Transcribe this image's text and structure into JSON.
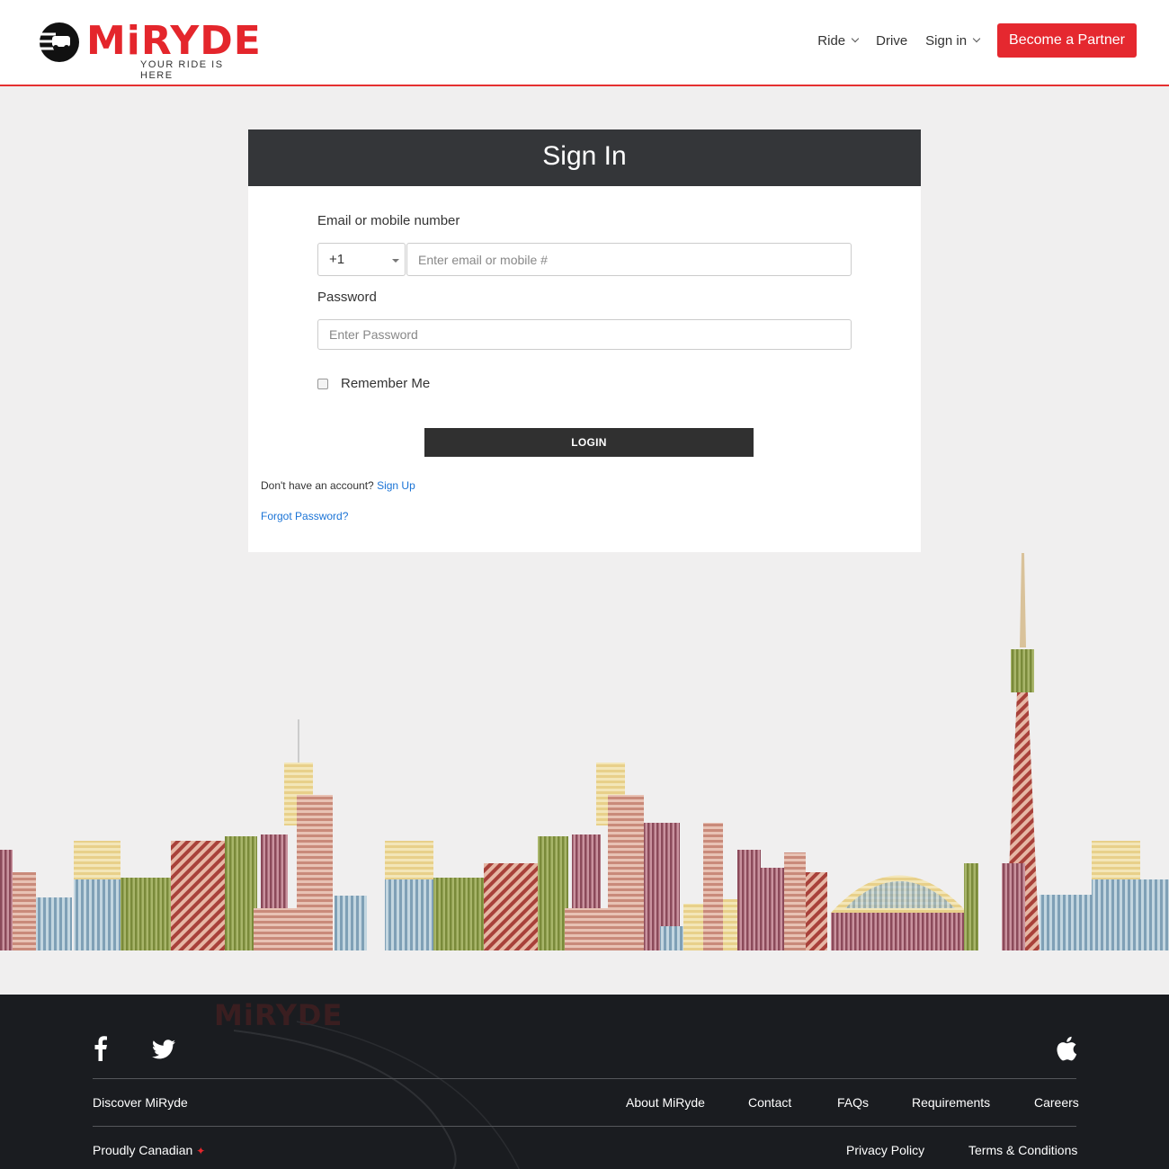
{
  "header": {
    "logo_text": "MiRYDE",
    "logo_tagline": "YOUR RIDE IS HERE",
    "nav": [
      {
        "label": "Ride",
        "has_dropdown": true
      },
      {
        "label": "Drive",
        "has_dropdown": false
      },
      {
        "label": "Sign in",
        "has_dropdown": true
      }
    ],
    "partner_button": "Become a Partner",
    "accent_color": "#e5282f"
  },
  "signin": {
    "title": "Sign In",
    "email_label": "Email or mobile number",
    "country_code": "+1",
    "email_placeholder": "Enter email or mobile #",
    "password_label": "Password",
    "password_placeholder": "Enter Password",
    "remember_label": "Remember Me",
    "remember_checked": false,
    "login_button": "LOGIN",
    "no_account_text": "Don't have an account?",
    "signup_link": "Sign Up",
    "forgot_link": "Forgot Password?"
  },
  "footer": {
    "watermark": "MiRYDE",
    "social_icons": [
      "facebook-icon",
      "twitter-icon"
    ],
    "app_icon": "apple-icon",
    "discover": "Discover MiRyde",
    "links_row1": [
      "About MiRyde",
      "Contact",
      "FAQs",
      "Requirements",
      "Careers"
    ],
    "proudly": "Proudly Canadian",
    "links_row2": [
      "Privacy Policy",
      "Terms & Conditions"
    ]
  }
}
